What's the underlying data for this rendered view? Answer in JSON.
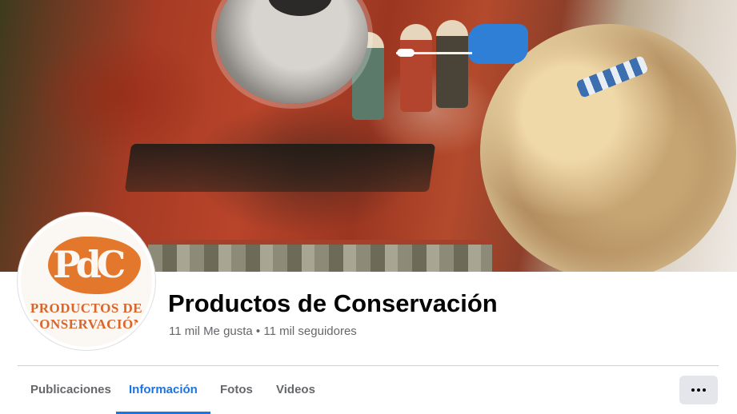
{
  "cover": {
    "description_icon": "cover-photo"
  },
  "profile": {
    "logo_monogram": "PdC",
    "logo_line1": "PRODUCTOS DE",
    "logo_line2": "CONSERVACIÓN"
  },
  "header": {
    "title": "Productos de Conservación",
    "stats": "11 mil Me gusta • 11 mil seguidores"
  },
  "tabs": [
    {
      "label": "Publicaciones",
      "active": false
    },
    {
      "label": "Información",
      "active": true
    },
    {
      "label": "Fotos",
      "active": false
    },
    {
      "label": "Videos",
      "active": false
    }
  ],
  "more_button": {
    "icon": "more-horizontal-icon"
  },
  "colors": {
    "accent": "#1b74e4",
    "logo_orange": "#e3782d",
    "muted_text": "#65676b"
  }
}
